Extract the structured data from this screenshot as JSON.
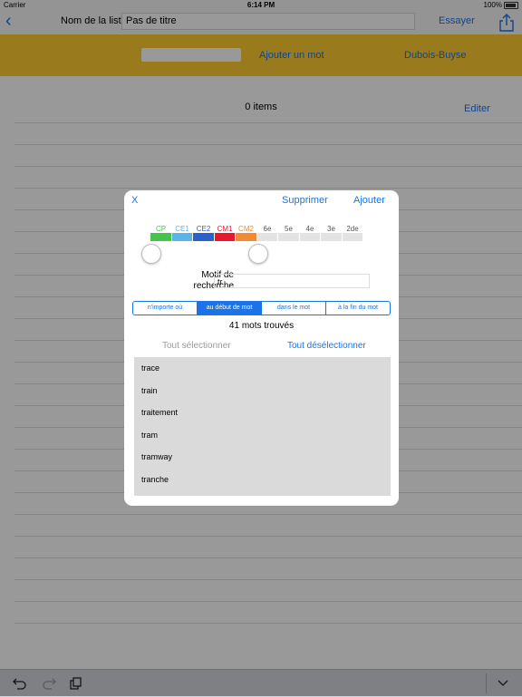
{
  "status_bar": {
    "carrier": "Carrier",
    "time": "6:14 PM",
    "battery": "100%"
  },
  "nav": {
    "back_glyph": "‹",
    "list_name_label": "Nom de la liste",
    "list_name_value": "Pas de titre",
    "try_label": "Essayer",
    "share_icon": "share-icon"
  },
  "yellow_bar": {
    "add_word": "Ajouter un mot",
    "dubois": "Dubois-Buyse"
  },
  "list": {
    "items_count": "0 items",
    "edit": "Editer"
  },
  "modal": {
    "close": "X",
    "delete": "Supprimer",
    "add": "Ajouter",
    "levels": [
      {
        "label": "CP",
        "color": "#44c44a",
        "active": true
      },
      {
        "label": "CE1",
        "color": "#5bb4e8",
        "active": true
      },
      {
        "label": "CE2",
        "color": "#2a62c9",
        "active": true
      },
      {
        "label": "CM1",
        "color": "#e8162f",
        "active": true
      },
      {
        "label": "CM2",
        "color": "#f08a35",
        "active": true
      },
      {
        "label": "6e",
        "color": "#e3e3e3",
        "active": false
      },
      {
        "label": "5e",
        "color": "#e3e3e3",
        "active": false
      },
      {
        "label": "4e",
        "color": "#e3e3e3",
        "active": false
      },
      {
        "label": "3e",
        "color": "#e3e3e3",
        "active": false
      },
      {
        "label": "2de",
        "color": "#e3e3e3",
        "active": false
      }
    ],
    "range": {
      "start_level": "CP",
      "end_level": "CM2"
    },
    "search_label_line1": "Motif de",
    "search_label_line2": "recherche",
    "search_value": "tr",
    "match_modes": [
      "n'importe où",
      "au début de mot",
      "dans le mot",
      "à la fin du mot"
    ],
    "selected_mode": "au début de mot",
    "found": "41 mots trouvés",
    "select_all": "Tout sélectionner",
    "deselect_all": "Tout désélectionner",
    "words": [
      "trace",
      "train",
      "traitement",
      "tram",
      "tramway",
      "tranche"
    ]
  },
  "toolbar": {
    "undo_icon": "undo-icon",
    "redo_icon": "redo-icon",
    "paste_icon": "paste-icon",
    "dismiss_icon": "keyboard-dismiss-icon"
  },
  "colors": {
    "accent": "#1a73e8",
    "yellow_bar": "#ffcc2f"
  }
}
